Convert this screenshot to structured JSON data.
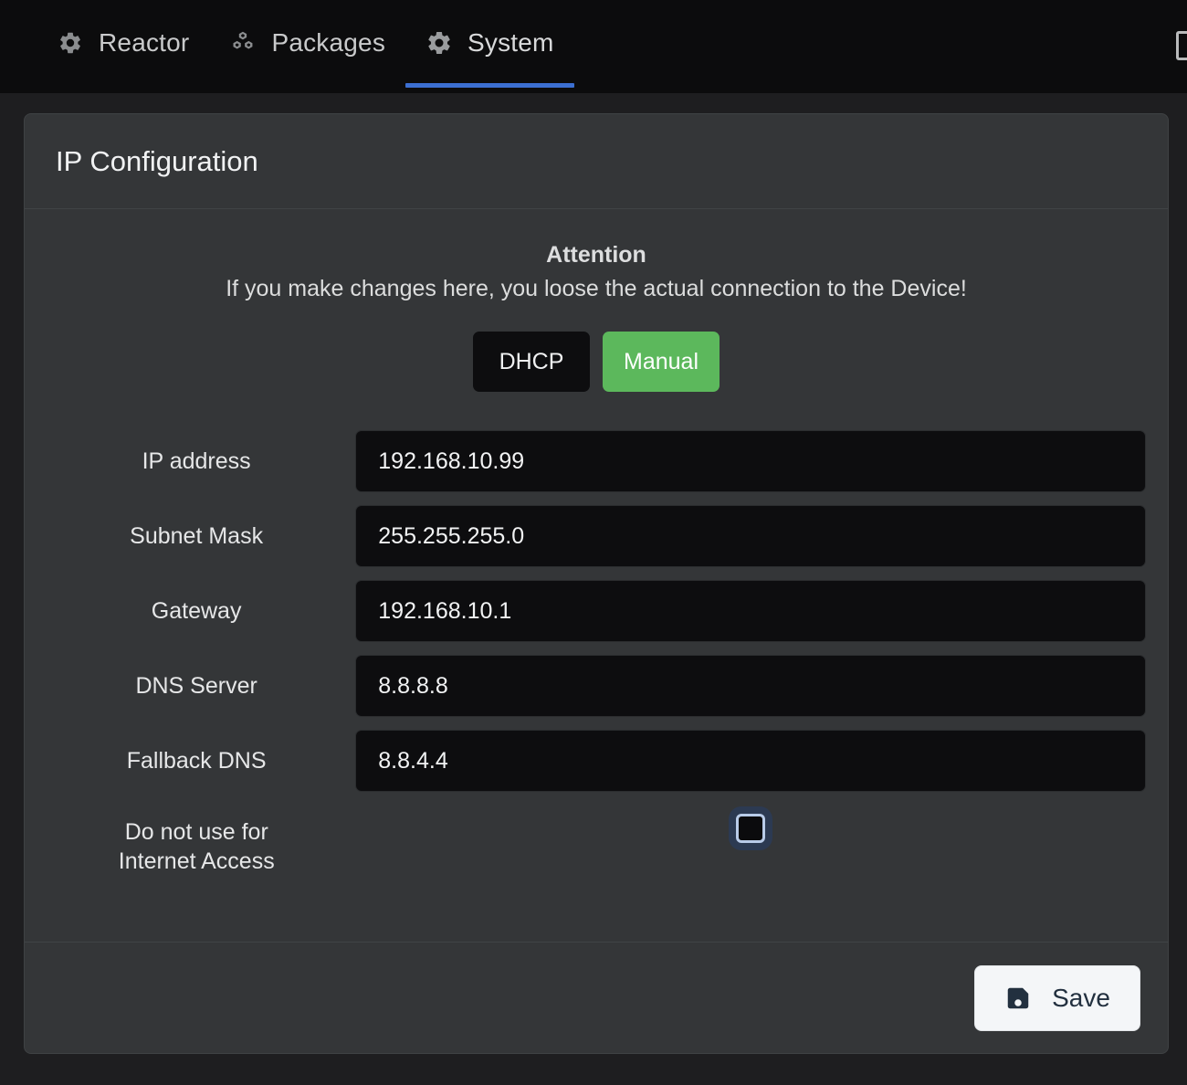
{
  "navbar": {
    "tabs": [
      {
        "label": "Reactor",
        "icon": "gear-icon",
        "active": false
      },
      {
        "label": "Packages",
        "icon": "boxes-icon",
        "active": false
      },
      {
        "label": "System",
        "icon": "gear-icon",
        "active": true
      }
    ],
    "active_underline_color": "#3c6fd1",
    "edge_icon": "panel-icon"
  },
  "card": {
    "title": "IP Configuration",
    "attention": {
      "title": "Attention",
      "message": "If you make changes here, you loose the actual connection to the Device!"
    },
    "mode": {
      "dhcp_label": "DHCP",
      "manual_label": "Manual",
      "selected": "Manual",
      "selected_color": "#5cb85c",
      "unselected_color": "#0d0d0f"
    },
    "fields": [
      {
        "label": "IP address",
        "value": "192.168.10.99",
        "placeholder": "IP address"
      },
      {
        "label": "Subnet Mask",
        "value": "255.255.255.0",
        "placeholder": "Subnet Mask"
      },
      {
        "label": "Gateway",
        "value": "192.168.10.1",
        "placeholder": "Gateway"
      },
      {
        "label": "DNS Server",
        "value": "8.8.8.8",
        "placeholder": "DNS Server"
      },
      {
        "label": "Fallback DNS",
        "value": "8.8.4.4",
        "placeholder": "Fallback DNS"
      }
    ],
    "checkbox": {
      "label_line1": "Do not use for",
      "label_line2": "Internet Access",
      "checked": false
    },
    "footer": {
      "save_label": "Save",
      "save_icon": "floppy-disk-icon"
    }
  }
}
